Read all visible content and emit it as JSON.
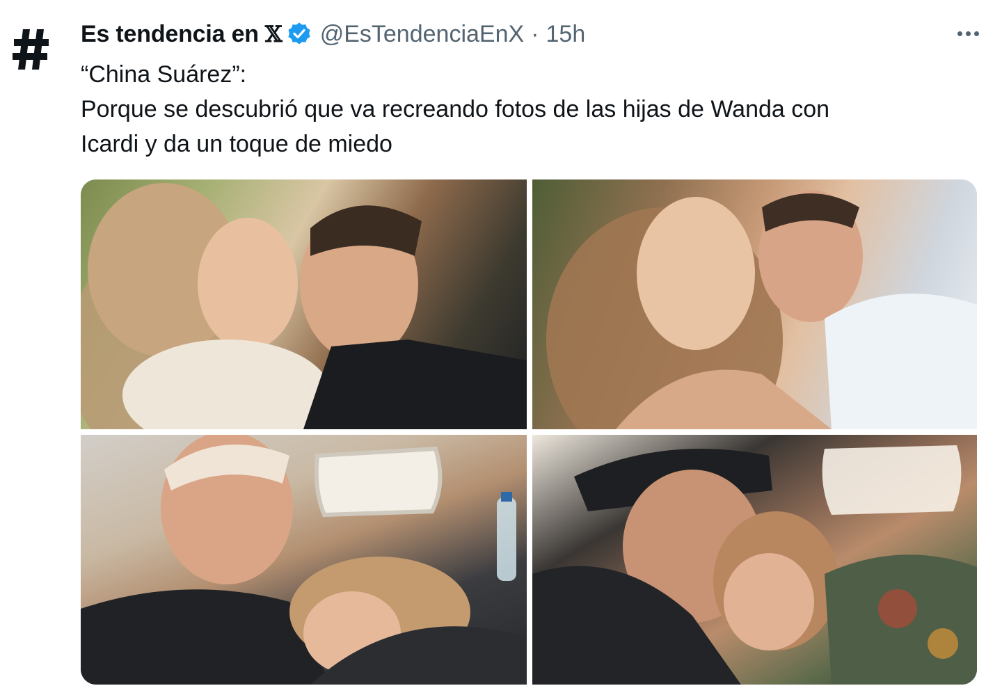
{
  "tweet": {
    "author": {
      "display_name": "Es tendencia en",
      "platform_mark": "𝕏",
      "handle": "@EsTendenciaEnX",
      "separator": "·",
      "time": "15h",
      "avatar_icon": "hashtag-icon",
      "verified_color": "#1d9bf0"
    },
    "text_lines": [
      "“China Suárez”:",
      "Porque se descubrió que va recreando fotos de las hijas de Wanda con",
      "Icardi y da un toque de miedo"
    ],
    "media_count": 4
  },
  "colors": {
    "text_primary": "#0f1419",
    "text_secondary": "#536471",
    "accent": "#1d9bf0"
  }
}
